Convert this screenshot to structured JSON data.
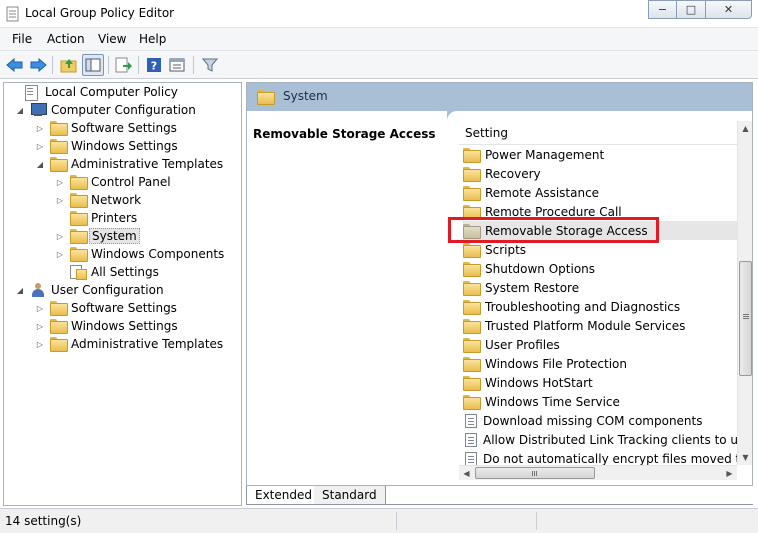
{
  "window": {
    "title": "Local Group Policy Editor",
    "buttons": {
      "minimize": "−",
      "maximize": "□",
      "close": "✕"
    }
  },
  "menu": [
    "File",
    "Action",
    "View",
    "Help"
  ],
  "toolbar": {
    "icons": [
      "back-arrow-icon",
      "forward-arrow-icon",
      "up-folder-icon",
      "show-hide-tree-icon",
      "export-list-icon",
      "help-icon",
      "properties-icon",
      "filter-icon"
    ]
  },
  "tree": [
    {
      "label": "Local Computer Policy",
      "icon": "policy-icon",
      "expander": ""
    },
    {
      "label": "Computer Configuration",
      "icon": "computer-icon",
      "expander": "◢"
    },
    {
      "label": "Software Settings",
      "icon": "folder-icon",
      "expander": "▷"
    },
    {
      "label": "Windows Settings",
      "icon": "folder-icon",
      "expander": "▷"
    },
    {
      "label": "Administrative Templates",
      "icon": "folder-icon",
      "expander": "◢"
    },
    {
      "label": "Control Panel",
      "icon": "folder-icon",
      "expander": "▷"
    },
    {
      "label": "Network",
      "icon": "folder-icon",
      "expander": "▷"
    },
    {
      "label": "Printers",
      "icon": "folder-icon",
      "expander": ""
    },
    {
      "label": "System",
      "icon": "folder-icon",
      "expander": "▷",
      "selected": true
    },
    {
      "label": "Windows Components",
      "icon": "folder-icon",
      "expander": "▷"
    },
    {
      "label": "All Settings",
      "icon": "all-settings-icon",
      "expander": ""
    },
    {
      "label": "User Configuration",
      "icon": "user-icon",
      "expander": "◢"
    },
    {
      "label": "Software Settings",
      "icon": "folder-icon",
      "expander": "▷"
    },
    {
      "label": "Windows Settings",
      "icon": "folder-icon",
      "expander": "▷"
    },
    {
      "label": "Administrative Templates",
      "icon": "folder-icon",
      "expander": "▷"
    }
  ],
  "right": {
    "header": "System",
    "description_title": "Removable Storage Access",
    "column_header": "Setting",
    "items": [
      {
        "label": "Power Management",
        "type": "folder"
      },
      {
        "label": "Recovery",
        "type": "folder"
      },
      {
        "label": "Remote Assistance",
        "type": "folder"
      },
      {
        "label": "Remote Procedure Call",
        "type": "folder"
      },
      {
        "label": "Removable Storage Access",
        "type": "folder",
        "selected": true
      },
      {
        "label": "Scripts",
        "type": "folder"
      },
      {
        "label": "Shutdown Options",
        "type": "folder"
      },
      {
        "label": "System Restore",
        "type": "folder"
      },
      {
        "label": "Troubleshooting and Diagnostics",
        "type": "folder"
      },
      {
        "label": "Trusted Platform Module Services",
        "type": "folder"
      },
      {
        "label": "User Profiles",
        "type": "folder"
      },
      {
        "label": "Windows File Protection",
        "type": "folder"
      },
      {
        "label": "Windows HotStart",
        "type": "folder"
      },
      {
        "label": "Windows Time Service",
        "type": "folder"
      },
      {
        "label": "Download missing COM components",
        "type": "setting"
      },
      {
        "label": "Allow Distributed Link Tracking clients to use do",
        "type": "setting"
      },
      {
        "label": "Do not automatically encrypt files moved to enc",
        "type": "setting"
      }
    ],
    "highlight_color": "#e01b24"
  },
  "tabs": {
    "extended": "Extended",
    "standard": "Standard"
  },
  "status": {
    "text": "14 setting(s)"
  }
}
